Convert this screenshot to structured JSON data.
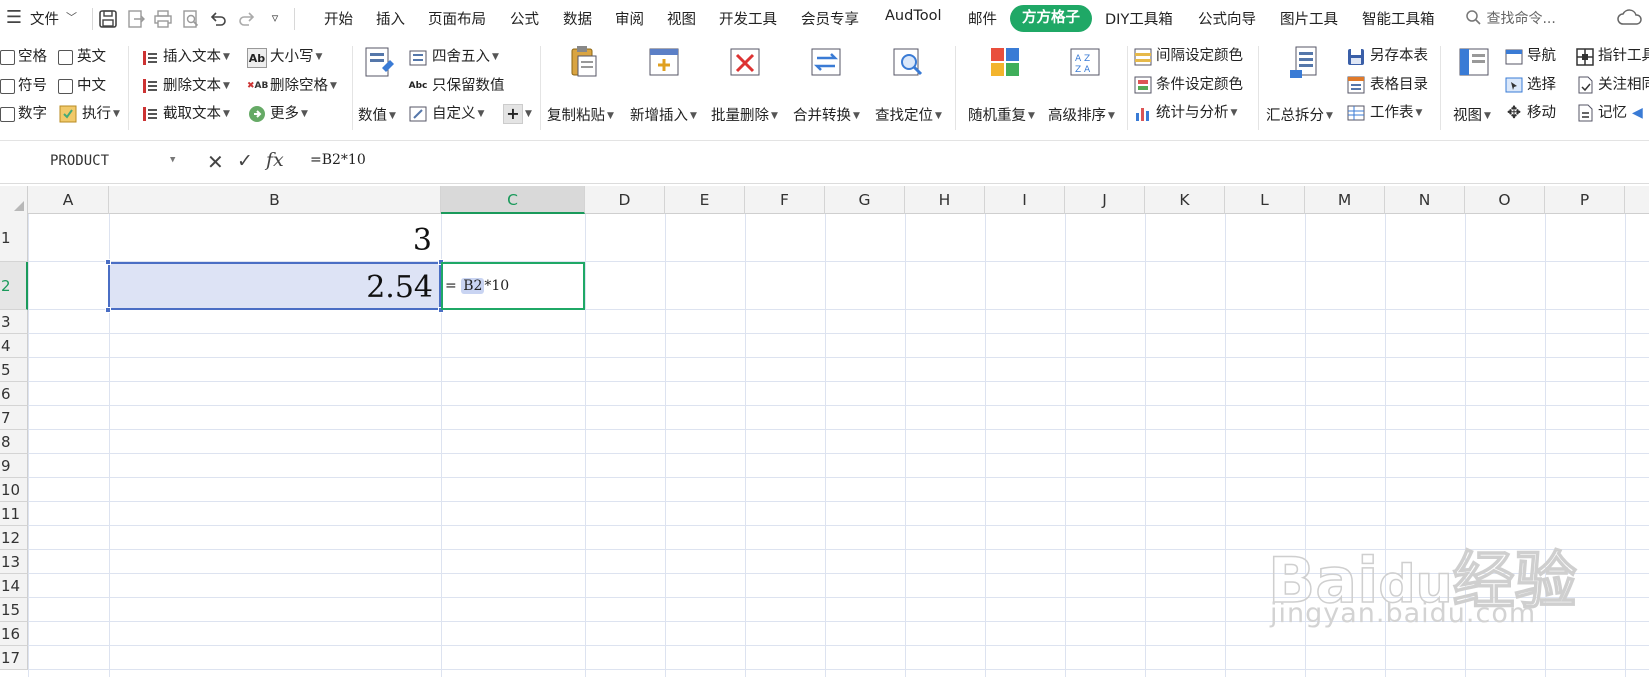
{
  "menubar": {
    "file": "文件",
    "tabs": [
      "开始",
      "插入",
      "页面布局",
      "公式",
      "数据",
      "审阅",
      "视图",
      "开发工具",
      "会员专享",
      "AudTool",
      "邮件"
    ],
    "active_tab": "方方格子",
    "tabs_after": [
      "DIY工具箱",
      "公式向导",
      "图片工具",
      "智能工具箱"
    ],
    "search": "查找命令..."
  },
  "ribbon": {
    "checks": [
      "空格",
      "英文",
      "符号",
      "中文",
      "数字"
    ],
    "execute": "执行",
    "text_group": [
      "插入文本",
      "删除文本",
      "截取文本"
    ],
    "case_group": [
      "大小写",
      "删除空格",
      "更多"
    ],
    "value": "数值",
    "round_group": [
      "四舍五入",
      "只保留数值",
      "自定义"
    ],
    "big_buttons": [
      "复制粘贴",
      "新增插入",
      "批量删除",
      "合并转换",
      "查找定位"
    ],
    "big_buttons2": [
      "随机重复",
      "高级排序"
    ],
    "color_group": [
      "间隔设定颜色",
      "条件设定颜色",
      "统计与分析"
    ],
    "summary": "汇总拆分",
    "sheet_group": [
      "另存本表",
      "表格目录",
      "工作表"
    ],
    "view": "视图",
    "nav_group": [
      "导航",
      "选择",
      "移动"
    ],
    "pointer_group": [
      "指针工具",
      "关注相同",
      "记忆"
    ]
  },
  "formula_bar": {
    "name_box": "PRODUCT",
    "fx": "fx",
    "formula": "=B2*10"
  },
  "sheet": {
    "columns": [
      "A",
      "B",
      "C",
      "D",
      "E",
      "F",
      "G",
      "H",
      "I",
      "J",
      "K",
      "L",
      "M",
      "N",
      "O",
      "P"
    ],
    "rows": [
      "1",
      "2",
      "3",
      "4",
      "5",
      "6",
      "7",
      "8",
      "9",
      "10",
      "11",
      "12",
      "13",
      "14",
      "15",
      "16",
      "17"
    ],
    "selected_column": "C",
    "selected_row": "2",
    "cells": {
      "B1": "3",
      "B2": "2.54",
      "C2_prefix": "=",
      "C2_ref": "B2",
      "C2_suffix": "*10"
    }
  },
  "watermark": {
    "logo": "Bai经验",
    "url": "jingyan.baidu.com"
  },
  "colors": {
    "accent": "#1fa866",
    "selection_fill": "#dde3f5",
    "selection_border": "#4a6ec4"
  }
}
